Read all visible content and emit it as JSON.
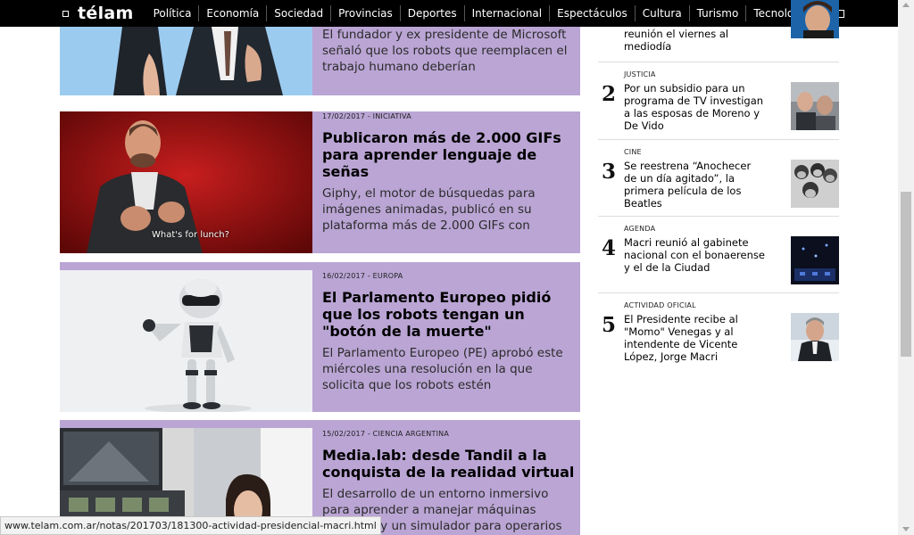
{
  "nav": {
    "logo": "télam",
    "items": [
      "Política",
      "Economía",
      "Sociedad",
      "Provincias",
      "Deportes",
      "Internacional",
      "Espectáculos",
      "Cultura",
      "Turismo",
      "Tecnología"
    ],
    "fb": "f",
    "sep": "|"
  },
  "articles": [
    {
      "title": "",
      "summary": "El fundador y ex presidente de Microsoft señaló que los robots que reemplacen el trabajo humano deberían"
    },
    {
      "meta": "17/02/2017 - INICIATIVA",
      "title": "Publicaron más de 2.000 GIFs para aprender lenguaje de señas",
      "summary": "Giphy, el motor de búsquedas para imágenes animadas, publicó en su plataforma más de 2.000 GIFs con",
      "caption": "What's for lunch?"
    },
    {
      "meta": "16/02/2017 - EUROPA",
      "title": "El Parlamento Europeo pidió que los robots tengan un \"botón de la muerte\"",
      "summary": "El Parlamento Europeo (PE) aprobó este miércoles una resolución en la que solicita que los robots estén"
    },
    {
      "meta": "15/02/2017 - CIENCIA ARGENTINA",
      "title": "Media.lab: desde Tandil a la conquista de la realidad virtual",
      "summary": "El desarrollo de un entorno inmersivo para aprender a manejar máquinas agrícolas y un simulador para operarios"
    }
  ],
  "sidebar": {
    "top_title": "reunión el viernes al mediodía",
    "items": [
      {
        "num": "2",
        "cat": "JUSTICIA",
        "title": "Por un subsidio para un programa de TV investigan a las esposas de Moreno y De Vido"
      },
      {
        "num": "3",
        "cat": "CINE",
        "title": "Se reestrena “Anochecer de un día agitado”, la primera película de los Beatles"
      },
      {
        "num": "4",
        "cat": "AGENDA",
        "title": "Macri reunió al gabinete nacional con el bonaerense y el de la Ciudad"
      },
      {
        "num": "5",
        "cat": "ACTIVIDAD OFICIAL",
        "title": "El Presidente recibe al \"Momo\" Venegas y al intendente de Vicente López, Jorge Macri"
      }
    ]
  },
  "status_url": "www.telam.com.ar/notas/201703/181300-actividad-presidencial-macri.html",
  "colors": {
    "card_bg": "#baa5d4",
    "nav_bg": "#000000"
  }
}
